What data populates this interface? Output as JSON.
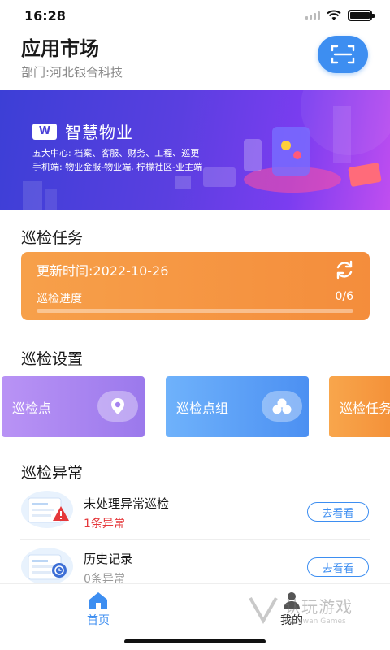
{
  "status_bar": {
    "time": "16:28"
  },
  "header": {
    "title": "应用市场",
    "department": "部门:河北银合科技"
  },
  "banner": {
    "logo_letter": "W",
    "title": "智慧物业",
    "line1": "五大中心: 档案、客服、财务、工程、巡更",
    "line2": "手机端: 物业金服-物业端, 柠檬社区-业主端"
  },
  "patrol_task": {
    "section_title": "巡检任务",
    "update_time": "更新时间:2022-10-26",
    "progress_label": "巡检进度",
    "progress_text": "0/6",
    "progress_fraction": 0
  },
  "patrol_settings": {
    "section_title": "巡检设置",
    "tiles": [
      {
        "label": "巡检点",
        "icon": "location-pin-icon"
      },
      {
        "label": "巡检点组",
        "icon": "group-circles-icon"
      },
      {
        "label": "巡检任务"
      }
    ]
  },
  "patrol_anomaly": {
    "section_title": "巡检异常",
    "items": [
      {
        "title": "未处理异常巡检",
        "count": "1条异常",
        "count_color": "#e5383b",
        "button": "去看看",
        "icon": "warning-document-icon"
      },
      {
        "title": "历史记录",
        "count": "0条异常",
        "count_color": "#999999",
        "button": "去看看",
        "icon": "history-document-icon"
      }
    ]
  },
  "tabbar": {
    "tabs": [
      {
        "label": "首页",
        "icon": "home-icon",
        "active": true
      },
      {
        "label": "我的",
        "icon": "user-icon",
        "active": false
      }
    ]
  },
  "watermark": {
    "text": "认玩游戏",
    "sub": "Rengwan Games"
  },
  "colors": {
    "accent": "#3d8ef1",
    "task_card": "#f48d3c",
    "alert": "#e5383b"
  }
}
